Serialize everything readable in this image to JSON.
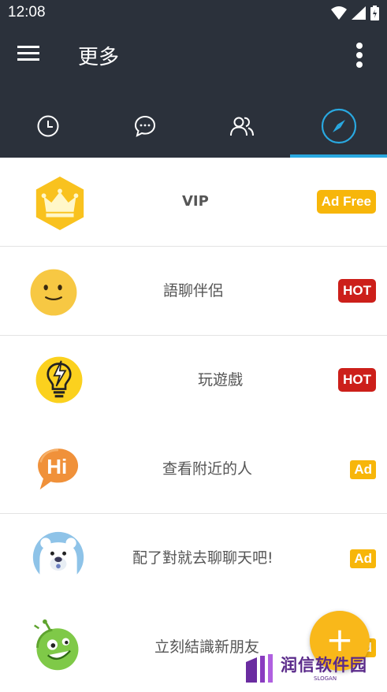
{
  "status_bar": {
    "time": "12:08",
    "icons": [
      "wifi-icon",
      "signal-icon",
      "battery-icon"
    ]
  },
  "app_bar": {
    "title": "更多",
    "menu_icon": "hamburger-menu-icon",
    "overflow_icon": "more-vertical-icon"
  },
  "tabs": [
    {
      "icon": "clock-icon",
      "selected": false
    },
    {
      "icon": "chat-bubble-icon",
      "selected": false
    },
    {
      "icon": "people-icon",
      "selected": false
    },
    {
      "icon": "compass-icon",
      "selected": true
    }
  ],
  "list": [
    {
      "icon": "crown-icon",
      "label": "VIP",
      "badge": "Ad Free",
      "badge_type": "ad"
    },
    {
      "icon": "smiley-icon",
      "label": "語聊伴侶",
      "badge": "HOT",
      "badge_type": "hot"
    },
    {
      "icon": "lightbulb-icon",
      "label": "玩遊戲",
      "badge": "HOT",
      "badge_type": "hot"
    },
    {
      "icon": "hi-bubble-icon",
      "label": "查看附近的人",
      "badge": "Ad",
      "badge_type": "ad"
    },
    {
      "icon": "polar-bear-icon",
      "label": "配了對就去聊聊天吧!",
      "badge": "Ad",
      "badge_type": "ad"
    },
    {
      "icon": "alien-face-icon",
      "label": "立刻結識新朋友",
      "badge": "Ad",
      "badge_type": "ad"
    }
  ],
  "fab": {
    "label": "+"
  },
  "watermark": {
    "text": "润信软件园",
    "sub": "SLOGAN"
  },
  "colors": {
    "app_bar": "#2b313b",
    "accent": "#29a8e0",
    "hot": "#cc1f1a",
    "ad": "#f7b60a",
    "fab": "#f9b81a"
  }
}
